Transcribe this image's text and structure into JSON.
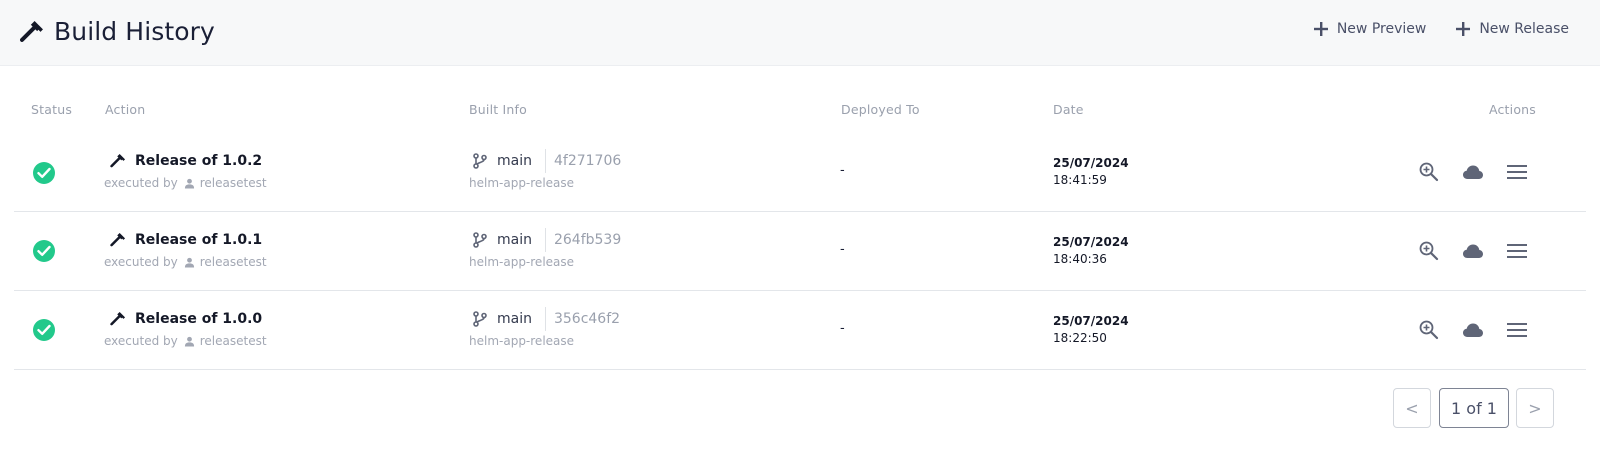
{
  "header": {
    "title": "Build History",
    "title_icon": "hammer-icon",
    "new_preview_label": "New Preview",
    "new_release_label": "New Release"
  },
  "columns": {
    "status": "Status",
    "action": "Action",
    "built_info": "Built Info",
    "deployed_to": "Deployed To",
    "date": "Date",
    "actions": "Actions"
  },
  "builds": [
    {
      "status": "success",
      "title": "Release of 1.0.2",
      "executed_by_label": "executed by",
      "user": "releasetest",
      "branch": "main",
      "commit": "4f271706",
      "repo": "helm-app-release",
      "deployed_to": "-",
      "date": "25/07/2024",
      "time": "18:41:59"
    },
    {
      "status": "success",
      "title": "Release of 1.0.1",
      "executed_by_label": "executed by",
      "user": "releasetest",
      "branch": "main",
      "commit": "264fb539",
      "repo": "helm-app-release",
      "deployed_to": "-",
      "date": "25/07/2024",
      "time": "18:40:36"
    },
    {
      "status": "success",
      "title": "Release of 1.0.0",
      "executed_by_label": "executed by",
      "user": "releasetest",
      "branch": "main",
      "commit": "356c46f2",
      "repo": "helm-app-release",
      "deployed_to": "-",
      "date": "25/07/2024",
      "time": "18:22:50"
    }
  ],
  "row_actions": [
    "zoom-in-icon",
    "cloud-icon",
    "menu-icon"
  ],
  "pagination": {
    "prev_label": "<",
    "page_label": "1 of 1",
    "next_label": ">"
  },
  "colors": {
    "success": "#22c98b",
    "icon_gray": "#5f6577",
    "text_dark": "#141827"
  }
}
